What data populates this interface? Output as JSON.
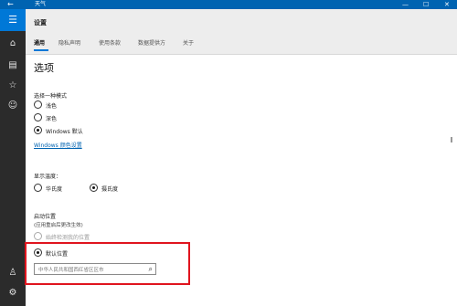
{
  "window": {
    "title": "天气"
  },
  "header": {
    "title": "设置",
    "tabs": [
      "通用",
      "隐私声明",
      "使用条款",
      "数据提供方",
      "关于"
    ]
  },
  "page": {
    "title": "选项"
  },
  "mode": {
    "label": "选择一种模式",
    "options": [
      "浅色",
      "深色",
      "Windows 默认"
    ],
    "selected": "Windows 默认",
    "link": "Windows 颜色设置"
  },
  "temperature": {
    "label": "显示温度：",
    "options": [
      "华氏度",
      "摄氏度"
    ],
    "selected": "摄氏度"
  },
  "location": {
    "label": "启动位置",
    "sublabel": "(应用重启后更改生效)",
    "options": [
      "始终检测我的位置",
      "默认位置"
    ],
    "selected": "默认位置",
    "search_placeholder": "中华人民共和国西红省区区市"
  },
  "icons": {
    "back": "back-arrow-icon",
    "menu": "hamburger-icon",
    "home": "home-icon",
    "maps": "maps-icon",
    "favorites": "star-icon",
    "news": "news-icon",
    "account": "account-icon",
    "settings": "gear-icon",
    "search": "search-icon"
  },
  "colors": {
    "accent": "#0078d7",
    "highlight": "#e0141e"
  }
}
